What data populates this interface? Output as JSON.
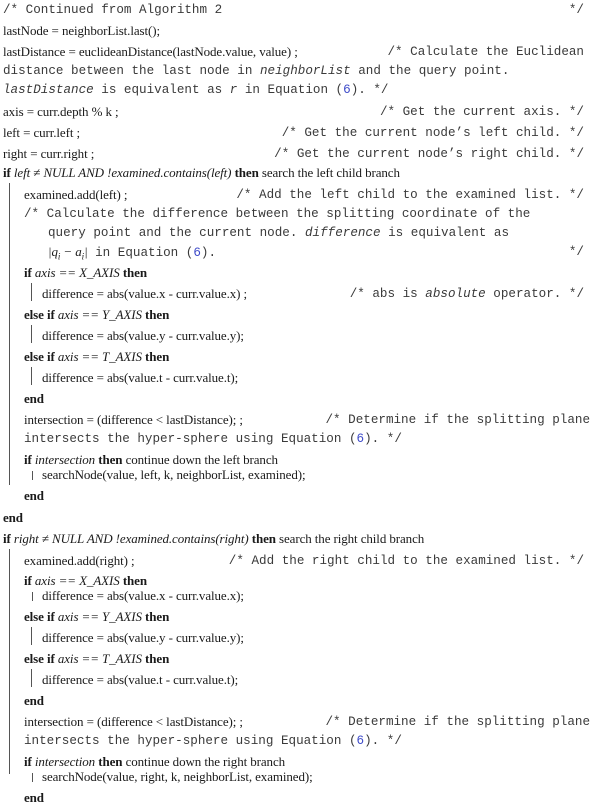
{
  "algorithm": {
    "header_comment": {
      "text": "/* Continued from Algorithm 2",
      "end": "*/"
    },
    "lines": {
      "lastNode": "lastNode = neighborList.last();",
      "lastDistance": "lastDistance = euclideanDistance(lastNode.value, value) ;",
      "lastDistance_comment_1": "/* Calculate the Euclidean",
      "lastDistance_comment_2a": "distance between the last node in ",
      "lastDistance_comment_2b": "neighborList",
      "lastDistance_comment_2c": " and the query point.",
      "lastDistance_comment_3a": "lastDistance",
      "lastDistance_comment_3b": " is equivalent as ",
      "lastDistance_comment_3c": "r",
      "lastDistance_comment_3d": " in Equation (",
      "lastDistance_comment_3e": "6",
      "lastDistance_comment_3f": ").  */",
      "axis": "axis = curr.depth % k ;",
      "axis_comment": "/* Get the current axis.  */",
      "left": "left = curr.left ;",
      "left_comment": "/* Get the current node’s left child.  */",
      "right": "right = curr.right ;",
      "right_comment": "/* Get the current node’s right child.  */"
    },
    "keywords": {
      "if": "if",
      "then": "then",
      "else_if": "else if",
      "end": "end"
    },
    "left_branch": {
      "condition": "left ≠ NULL AND !examined.contains(left)",
      "then_text": " search the left child branch",
      "examined_add": "examined.add(left) ;",
      "examined_add_comment": "/* Add the left child to the examined list.  */",
      "diff_comment_1": "/* Calculate the difference between the splitting coordinate of the",
      "diff_comment_2a": "query point and the current node.  ",
      "diff_comment_2b": "difference",
      "diff_comment_2c": " is equivalent as",
      "diff_comment_3a": "|q",
      "diff_comment_3sub1": "i",
      "diff_comment_3b": " − a",
      "diff_comment_3sub2": "i",
      "diff_comment_3c": "|",
      "diff_comment_3d": " in Equation (",
      "diff_comment_3e": "6",
      "diff_comment_3f": ").",
      "diff_comment_end": "*/",
      "cond_x": "axis == X_AXIS",
      "diff_x": "difference = abs(value.x - curr.value.x) ;",
      "abs_comment_a": "/* abs is ",
      "abs_comment_b": "absolute",
      "abs_comment_c": " operator.  */",
      "cond_y": "axis == Y_AXIS",
      "diff_y": "difference = abs(value.y - curr.value.y);",
      "cond_t": "axis == T_AXIS",
      "diff_t": "difference = abs(value.t - curr.value.t);",
      "intersection": "intersection = (difference < lastDistance); ;",
      "intersection_comment_1": "/* Determine if the splitting plane",
      "intersection_comment_2a": "intersects the hyper-sphere using Equation (",
      "intersection_comment_2b": "6",
      "intersection_comment_2c": ").  */",
      "cond_intersection": "intersection",
      "continue_text": " continue down the left branch",
      "search_call": "searchNode(value, left, k, neighborList, examined);"
    },
    "right_branch": {
      "condition": "right ≠ NULL AND !examined.contains(right)",
      "then_text": " search the right child branch",
      "examined_add": "examined.add(right) ;",
      "examined_add_comment": "/* Add the right child to the examined list.  */",
      "cond_x": "axis == X_AXIS",
      "diff_x": "difference = abs(value.x - curr.value.x);",
      "cond_y": "axis == Y_AXIS",
      "diff_y": "difference = abs(value.y - curr.value.y);",
      "cond_t": "axis == T_AXIS",
      "diff_t": "difference = abs(value.t - curr.value.t);",
      "intersection": "intersection = (difference < lastDistance); ;",
      "intersection_comment_1": "/* Determine if the splitting plane",
      "intersection_comment_2a": "intersects the hyper-sphere using Equation (",
      "intersection_comment_2b": "6",
      "intersection_comment_2c": ").  */",
      "cond_intersection": "intersection",
      "continue_text": " continue down the right branch",
      "search_call": "searchNode(value, right, k, neighborList, examined);"
    }
  }
}
